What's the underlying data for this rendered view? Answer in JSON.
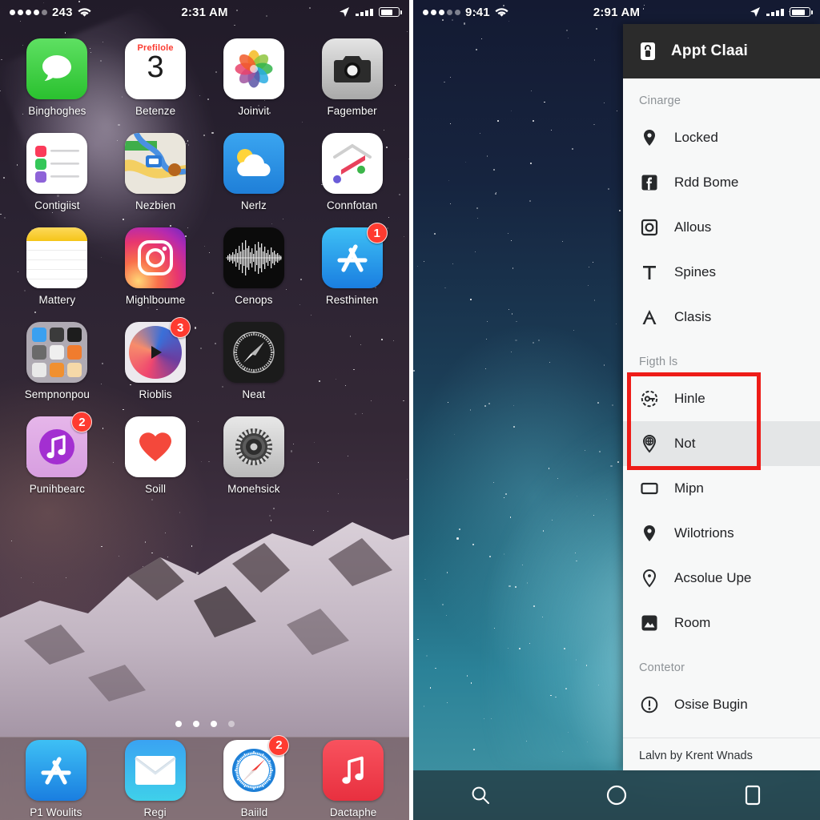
{
  "left_phone": {
    "status_bar": {
      "carrier_signal_dots": 5,
      "carrier_label": "243",
      "wifi_icon": "wifi-icon",
      "time": "2:31 AM",
      "location_icon": "location-arrow-icon",
      "alarm_icon": "signal-icon",
      "battery_icon": "battery-icon"
    },
    "apps": [
      {
        "label": "Binghoghes",
        "icon": "messages-icon",
        "badge": null
      },
      {
        "label": "Betenze",
        "icon": "calendar-icon",
        "badge": null,
        "cal_month": "Prefilole",
        "cal_day": "3"
      },
      {
        "label": "Joinvit",
        "icon": "photos-icon",
        "badge": null
      },
      {
        "label": "Fagember",
        "icon": "camera-icon",
        "badge": null
      },
      {
        "label": "Contigiist",
        "icon": "reminders-icon",
        "badge": null
      },
      {
        "label": "Nezbien",
        "icon": "maps-icon",
        "badge": null
      },
      {
        "label": "Nerlz",
        "icon": "weather-icon",
        "badge": null
      },
      {
        "label": "Connfotan",
        "icon": "itunes-store-icon",
        "badge": null
      },
      {
        "label": "Mattery",
        "icon": "notes-icon",
        "badge": null
      },
      {
        "label": "Mighlboume",
        "icon": "instagram-icon",
        "badge": null
      },
      {
        "label": "Cenops",
        "icon": "voice-memos-icon",
        "badge": null
      },
      {
        "label": "Resthinten",
        "icon": "app-store-icon",
        "badge": "1"
      },
      {
        "label": "Sempnonpou",
        "icon": "folder-icon",
        "badge": null
      },
      {
        "label": "Rioblis",
        "icon": "media-player-icon",
        "badge": "3"
      },
      {
        "label": "Neat",
        "icon": "safari-compass-icon",
        "badge": null
      },
      {
        "label": "",
        "icon": "empty-slot",
        "badge": null
      },
      {
        "label": "Punihbearc",
        "icon": "music-purple-icon",
        "badge": "2"
      },
      {
        "label": "Soill",
        "icon": "health-heart-icon",
        "badge": null
      },
      {
        "label": "Monehsick",
        "icon": "settings-gear-icon",
        "badge": null
      }
    ],
    "page_dots": {
      "count": 4,
      "active_index": 3
    },
    "dock": [
      {
        "label": "P1 Woulits",
        "icon": "app-store-icon",
        "badge": null
      },
      {
        "label": "Regi",
        "icon": "mail-icon",
        "badge": null
      },
      {
        "label": "Baiild",
        "icon": "safari-icon",
        "badge": "2"
      },
      {
        "label": "Dactaphe",
        "icon": "music-icon",
        "badge": null
      }
    ]
  },
  "right_phone": {
    "status_bar": {
      "carrier_signal_dots": 5,
      "carrier_label": "9:41",
      "wifi_icon": "wifi-icon",
      "time": "2:91 AM",
      "location_icon": "location-arrow-icon",
      "alarm_icon": "signal-icon",
      "battery_icon": "battery-icon"
    },
    "drawer": {
      "header": {
        "icon": "lock-app-icon",
        "title": "Appt Claai"
      },
      "sections": [
        {
          "label": "Cinarge",
          "items": [
            {
              "label": "Locked",
              "icon": "location-pin-icon",
              "selected": false
            },
            {
              "label": "Rdd Bome",
              "icon": "facebook-icon",
              "selected": false
            },
            {
              "label": "Allous",
              "icon": "camera-square-icon",
              "selected": false
            },
            {
              "label": "Spines",
              "icon": "text-t-icon",
              "selected": false
            },
            {
              "label": "Clasis",
              "icon": "letter-a-icon",
              "selected": false
            }
          ]
        },
        {
          "label": "Figth ls",
          "highlighted": true,
          "items": [
            {
              "label": "Hinle",
              "icon": "key-circle-icon",
              "selected": false
            },
            {
              "label": "Not",
              "icon": "globe-pin-icon",
              "selected": true
            },
            {
              "label": "Mipn",
              "icon": "rectangle-icon",
              "selected": false
            },
            {
              "label": "Wilotrions",
              "icon": "location-pin-icon",
              "selected": false
            },
            {
              "label": "Acsolue Upe",
              "icon": "pin-dot-icon",
              "selected": false
            },
            {
              "label": "Room",
              "icon": "image-square-icon",
              "selected": false
            }
          ]
        },
        {
          "label": "Contetor",
          "items": [
            {
              "label": "Osise Bugin",
              "icon": "alert-circle-icon",
              "selected": false
            }
          ]
        }
      ],
      "footer": "Lalvn by Krent Wnads"
    },
    "navbar": [
      {
        "name": "search-nav-button",
        "icon": "search-icon"
      },
      {
        "name": "home-nav-button",
        "icon": "circle-icon"
      },
      {
        "name": "recents-nav-button",
        "icon": "square-icon"
      }
    ]
  },
  "colors": {
    "badge_red": "#ff3b30",
    "highlight_red": "#ee1c18",
    "drawer_bg": "#f7f8f8",
    "drawer_header_bg": "#2b2b2b",
    "selected_row_bg": "#e4e6e7"
  }
}
